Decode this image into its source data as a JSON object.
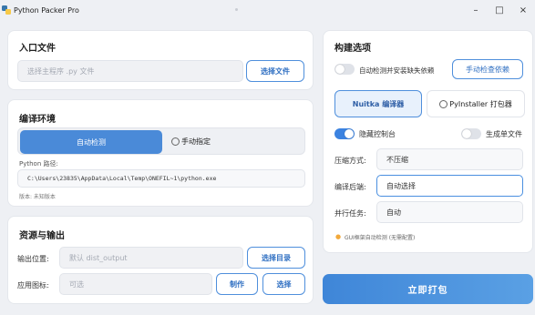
{
  "window": {
    "title": "Python Packer Pro",
    "minimize": "–",
    "maximize": "□",
    "close": "×"
  },
  "entry_card": {
    "title": "入口文件",
    "placeholder": "选择主程序 .py 文件",
    "select_button": "选择文件"
  },
  "env_card": {
    "title": "编译环境",
    "modes": [
      "自动检测",
      "手动指定"
    ],
    "active_mode": "自动检测",
    "python_path_label": "Python 路径:",
    "python_path": "C:\\Users\\23835\\AppData\\Local\\Temp\\ONEFIL~1\\python.exe",
    "version_text": "版本: 未知版本"
  },
  "resource_card": {
    "title": "资源与输出",
    "output_label": "输出位置:",
    "output_placeholder": "默认 dist_output",
    "output_button": "选择目录",
    "icon_label": "应用图标:",
    "icon_placeholder": "可选",
    "make_button": "制作",
    "choose_button": "选择"
  },
  "build_card": {
    "title": "构建选项",
    "auto_install_label": "自动检测并安装缺失依赖",
    "auto_install_on": false,
    "manual_check_button": "手动检查依赖",
    "engines": [
      "Nuitka 编译器",
      "PyInstaller 打包器"
    ],
    "active_engine": "Nuitka 编译器",
    "hide_console_label": "隐藏控制台",
    "hide_console_on": true,
    "single_file_label": "生成单文件",
    "single_file_on": false,
    "compress_label": "压缩方式:",
    "compress_value": "不压缩",
    "post_compile_label": "编译后端:",
    "post_compile_value": "自动选择",
    "parallel_label": "并行任务:",
    "parallel_value": "自动",
    "hint": "GUI框架自动检测 (无需配置)"
  },
  "primary_button": "立即打包",
  "colors": {
    "accent": "#4a8ad8",
    "background": "#eef0f4",
    "card": "#ffffff"
  }
}
